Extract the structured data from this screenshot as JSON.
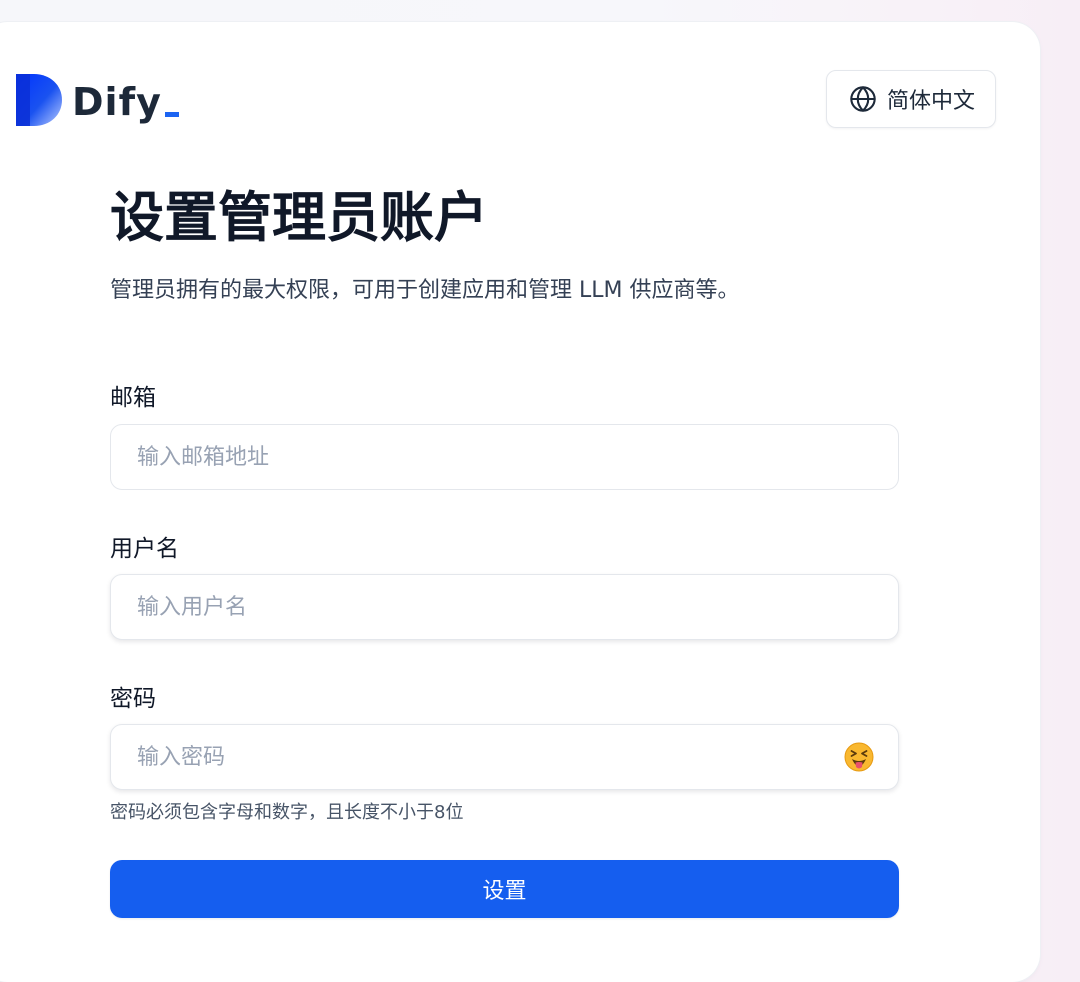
{
  "app": {
    "logo_text": "Dify"
  },
  "header": {
    "language_label": "简体中文",
    "language_icon": "globe-icon"
  },
  "main": {
    "title": "设置管理员账户",
    "subtitle": "管理员拥有的最大权限，可用于创建应用和管理 LLM 供应商等。"
  },
  "form": {
    "email": {
      "label": "邮箱",
      "placeholder": "输入邮箱地址",
      "value": ""
    },
    "username": {
      "label": "用户名",
      "placeholder": "输入用户名",
      "value": ""
    },
    "password": {
      "label": "密码",
      "placeholder": "输入密码",
      "value": "",
      "toggle_icon": "squinting-face-with-tongue-emoji-icon",
      "hint": "密码必须包含字母和数字，且长度不小于8位"
    },
    "submit_label": "设置"
  },
  "colors": {
    "primary": "#155eef",
    "logo_underscore": "#1c64f2",
    "title": "#101828",
    "placeholder": "#98a2b3"
  }
}
